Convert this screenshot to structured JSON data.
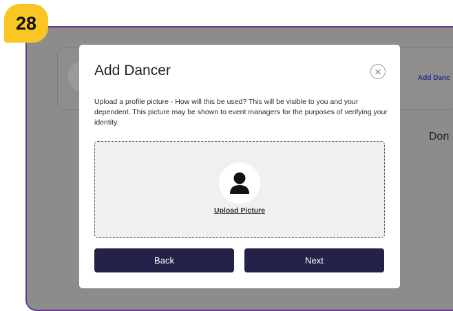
{
  "step": {
    "number": "28"
  },
  "background": {
    "link_text": "Add Danc",
    "partial_text": "Don"
  },
  "modal": {
    "title": "Add Dancer",
    "close_icon_glyph": "✕",
    "description": "Upload a profile picture - How will this be used? This will be visible to you and your dependent. This picture may be shown to event managers for the purposes of verifying your identity.",
    "upload_label": "Upload Picture",
    "back_label": "Back",
    "next_label": "Next"
  },
  "colors": {
    "badge": "#f9c623",
    "frame_border": "#6b3a8c",
    "button": "#25224a",
    "overlay": "#8c8c8c"
  },
  "icons": {
    "close": "close-icon",
    "avatar": "user-silhouette-icon"
  }
}
